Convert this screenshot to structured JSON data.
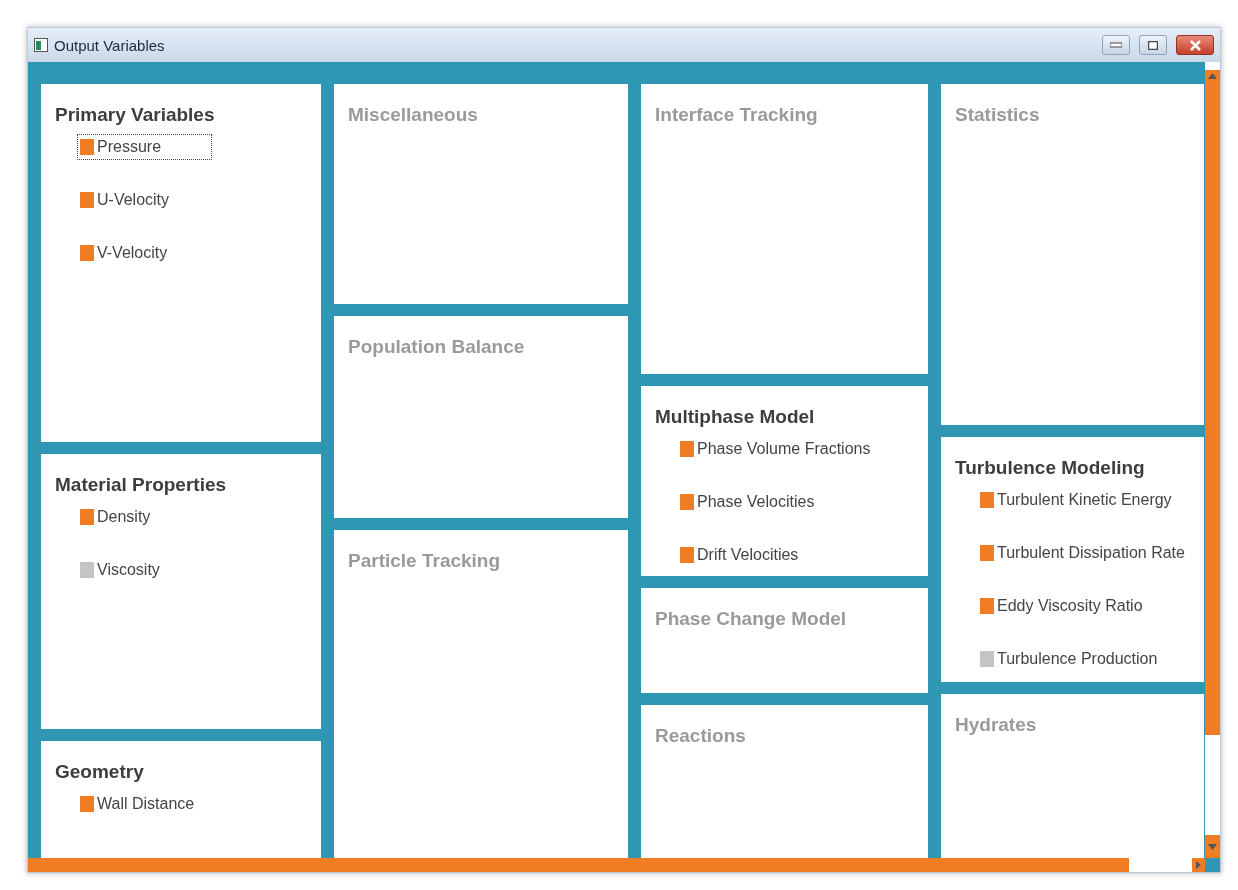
{
  "window": {
    "title": "Output Variables"
  },
  "columns": [
    {
      "panels": [
        {
          "title": "Primary Variables",
          "enabled": true,
          "items": [
            {
              "label": "Pressure",
              "on": true,
              "focused": true
            },
            {
              "label": "U-Velocity",
              "on": true,
              "focused": false
            },
            {
              "label": "V-Velocity",
              "on": true,
              "focused": false
            }
          ]
        },
        {
          "title": "Material Properties",
          "enabled": true,
          "items": [
            {
              "label": "Density",
              "on": true,
              "focused": false
            },
            {
              "label": "Viscosity",
              "on": false,
              "focused": false
            }
          ]
        },
        {
          "title": "Geometry",
          "enabled": true,
          "items": [
            {
              "label": "Wall Distance",
              "on": true,
              "focused": false
            }
          ]
        }
      ]
    },
    {
      "panels": [
        {
          "title": "Miscellaneous",
          "enabled": false
        },
        {
          "title": "Population Balance",
          "enabled": false
        },
        {
          "title": "Particle Tracking",
          "enabled": false
        }
      ]
    },
    {
      "panels": [
        {
          "title": "Interface Tracking",
          "enabled": false
        },
        {
          "title": "Multiphase Model",
          "enabled": true,
          "items": [
            {
              "label": "Phase Volume Fractions",
              "on": true,
              "focused": false
            },
            {
              "label": "Phase Velocities",
              "on": true,
              "focused": false
            },
            {
              "label": "Drift Velocities",
              "on": true,
              "focused": false
            }
          ]
        },
        {
          "title": "Phase Change Model",
          "enabled": false
        },
        {
          "title": "Reactions",
          "enabled": false
        }
      ]
    },
    {
      "panels": [
        {
          "title": "Statistics",
          "enabled": false
        },
        {
          "title": "Turbulence Modeling",
          "enabled": true,
          "items": [
            {
              "label": "Turbulent Kinetic Energy",
              "on": true,
              "focused": false
            },
            {
              "label": "Turbulent Dissipation Rate",
              "on": true,
              "focused": false
            },
            {
              "label": "Eddy Viscosity Ratio",
              "on": true,
              "focused": false
            },
            {
              "label": "Turbulence Production",
              "on": false,
              "focused": false
            }
          ]
        },
        {
          "title": "Hydrates",
          "enabled": false
        }
      ]
    }
  ]
}
